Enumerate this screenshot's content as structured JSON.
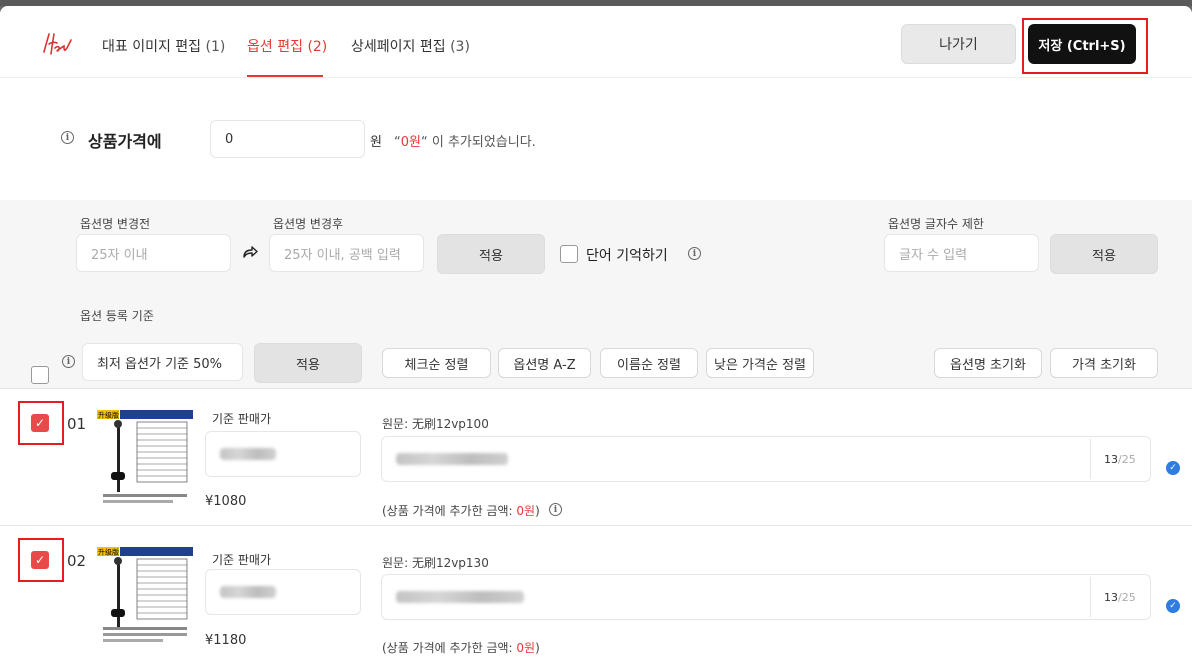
{
  "header": {
    "tabs": [
      {
        "label": "대표 이미지 편집",
        "count": "(1)"
      },
      {
        "label": "옵션 편집",
        "count": "(2)"
      },
      {
        "label": "상세페이지 편집",
        "count": "(3)"
      }
    ],
    "exit_label": "나가기",
    "save_label": "저장 (Ctrl+S)"
  },
  "price": {
    "label": "상품가격에",
    "value": "0",
    "unit": "원",
    "note_prefix": "“",
    "note_amount": "0원",
    "note_suffix": "“ 이 추가되었습니다."
  },
  "rename": {
    "before_label": "옵션명 변경전",
    "before_placeholder": "25자 이내",
    "after_label": "옵션명 변경후",
    "after_placeholder": "25자 이내, 공백 입력",
    "apply_label": "적용",
    "remember_label": "단어 기억하기",
    "limit_label": "옵션명 글자수 제한",
    "limit_placeholder": "글자 수 입력",
    "limit_apply_label": "적용"
  },
  "register": {
    "label": "옵션 등록 기준",
    "value": "최저 옵션가 기준 50%",
    "apply_label": "적용"
  },
  "sort_buttons": [
    "체크순 정렬",
    "옵션명 A-Z",
    "이름순 정렬",
    "낮은 가격순 정렬"
  ],
  "reset_buttons": [
    "옵션명 초기화",
    "가격 초기화"
  ],
  "options": [
    {
      "num": "01",
      "base_price_label": "기준 판매가",
      "price": "¥1080",
      "original": "원문: 无刷12vp100",
      "count": "13",
      "max": "/25",
      "added_prefix": "(상품 가격에 추가한 금액: ",
      "added_amount": "0원",
      "added_suffix": ")",
      "thumb_tag": "升级版"
    },
    {
      "num": "02",
      "base_price_label": "기준 판매가",
      "price": "¥1180",
      "original": "원문: 无刷12vp130",
      "count": "13",
      "max": "/25",
      "added_prefix": "(상품 가격에 추가한 금액: ",
      "added_amount": "0원",
      "added_suffix": ")",
      "thumb_tag": "升级版"
    }
  ],
  "colors": {
    "accent": "#e53935",
    "save_bg": "#111111",
    "highlight": "#e41e1e",
    "check_blue": "#2f7de1"
  }
}
